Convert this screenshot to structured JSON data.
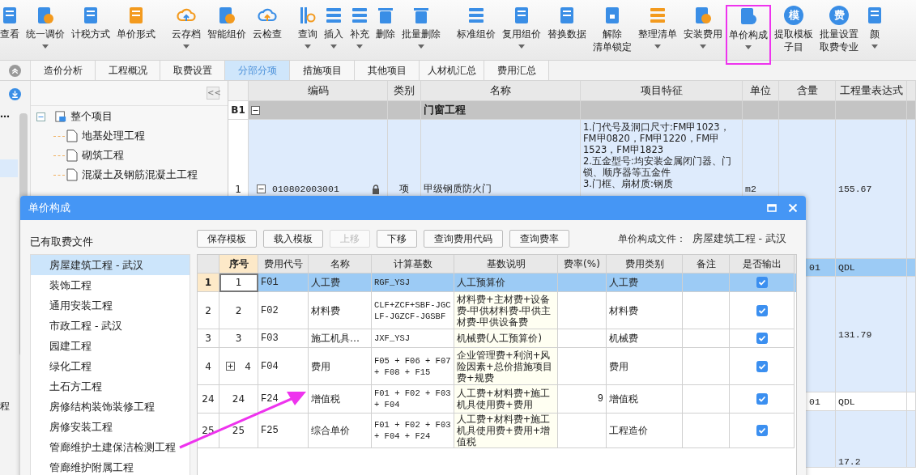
{
  "toolbar": {
    "groups": [
      [
        {
          "lines": [
            "查看"
          ],
          "dropdown": false,
          "highlighted": false
        },
        {
          "lines": [
            "统一调价"
          ],
          "dropdown": true,
          "highlighted": false
        },
        {
          "lines": [
            "计税方式"
          ],
          "dropdown": false,
          "highlighted": false
        },
        {
          "lines": [
            "单价形式"
          ],
          "dropdown": false,
          "highlighted": false
        }
      ],
      [
        {
          "lines": [
            "云存档"
          ],
          "dropdown": true,
          "highlighted": false
        },
        {
          "lines": [
            "智能组价"
          ],
          "dropdown": false,
          "highlighted": false
        },
        {
          "lines": [
            "云检查"
          ],
          "dropdown": false,
          "highlighted": false
        }
      ],
      [
        {
          "lines": [
            "查询"
          ],
          "dropdown": true,
          "highlighted": false
        },
        {
          "lines": [
            "插入"
          ],
          "dropdown": true,
          "highlighted": false
        },
        {
          "lines": [
            "补充"
          ],
          "dropdown": true,
          "highlighted": false
        },
        {
          "lines": [
            "删除"
          ],
          "dropdown": false,
          "highlighted": false
        },
        {
          "lines": [
            "批量删除"
          ],
          "dropdown": true,
          "highlighted": false
        }
      ],
      [
        {
          "lines": [
            "标准组价"
          ],
          "dropdown": false,
          "highlighted": false
        },
        {
          "lines": [
            "复用组价"
          ],
          "dropdown": true,
          "highlighted": false
        },
        {
          "lines": [
            "替换数据"
          ],
          "dropdown": false,
          "highlighted": false
        },
        {
          "lines": [
            "解除",
            "清单锁定"
          ],
          "dropdown": false,
          "highlighted": false
        },
        {
          "lines": [
            "整理清单"
          ],
          "dropdown": true,
          "highlighted": false
        },
        {
          "lines": [
            "安装费用"
          ],
          "dropdown": true,
          "highlighted": false
        },
        {
          "lines": [
            "单价构成"
          ],
          "dropdown": true,
          "highlighted": true
        },
        {
          "lines": [
            "提取模板",
            "子目"
          ],
          "dropdown": false,
          "highlighted": false,
          "icon_text": "模"
        },
        {
          "lines": [
            "批量设置",
            "取费专业"
          ],
          "dropdown": false,
          "highlighted": false,
          "icon_text": "费"
        },
        {
          "lines": [
            "颜"
          ],
          "dropdown": true,
          "highlighted": false
        }
      ]
    ]
  },
  "tabs": [
    {
      "label": "造价分析",
      "selected": false
    },
    {
      "label": "工程概况",
      "selected": false
    },
    {
      "label": "取费设置",
      "selected": false
    },
    {
      "label": "分部分项",
      "selected": true
    },
    {
      "label": "措施项目",
      "selected": false
    },
    {
      "label": "其他项目",
      "selected": false
    },
    {
      "label": "人材机汇总",
      "selected": false
    },
    {
      "label": "费用汇总",
      "selected": false
    }
  ],
  "left_strip": {
    "cut_item": "…",
    "cut_text": "程"
  },
  "tree": {
    "collapse_button": "<<",
    "root": {
      "label": "整个项目",
      "expanded": true,
      "children": [
        {
          "label": "地基处理工程"
        },
        {
          "label": "砌筑工程"
        },
        {
          "label": "混凝土及钢筋混凝土工程"
        }
      ]
    }
  },
  "grid": {
    "columns": [
      "编码",
      "类别",
      "名称",
      "项目特征",
      "单位",
      "含量",
      "工程量表达式"
    ],
    "rows": [
      {
        "kind": "group",
        "row_no": "B1",
        "expanded": true,
        "name": "门窗工程",
        "selected": false
      },
      {
        "kind": "item",
        "row_no": "1",
        "code": "010802003001",
        "expanded": true,
        "locked": true,
        "type": "项",
        "name": "甲级钢质防火门",
        "features": [
          "1.门代号及洞口尺寸:FM甲1023，FM甲0820，FM甲1220，FM甲1523，FM甲1823",
          "2.五金型号:均安装金属闭门器、门锁、顺序器等五金件",
          "3.门框、扇材质:钢质"
        ],
        "unit": "m2",
        "expression": "155.67",
        "selected": false
      },
      {
        "kind": "other",
        "content": "01",
        "expression": "QDL",
        "selected": true
      },
      {
        "kind": "other",
        "expression": "131.79",
        "selected": false
      },
      {
        "kind": "other",
        "content": "01",
        "expression": "QDL",
        "selected": false
      },
      {
        "kind": "other",
        "expression": "17.2",
        "selected": false
      }
    ]
  },
  "dialog": {
    "title": "单价构成",
    "fee_files_label": "已有取费文件",
    "fee_files": [
      {
        "label": "房屋建筑工程 - 武汉",
        "selected": true
      },
      {
        "label": "装饰工程",
        "selected": false
      },
      {
        "label": "通用安装工程",
        "selected": false
      },
      {
        "label": "市政工程 - 武汉",
        "selected": false
      },
      {
        "label": "园建工程",
        "selected": false
      },
      {
        "label": "绿化工程",
        "selected": false
      },
      {
        "label": "土石方工程",
        "selected": false
      },
      {
        "label": "房修结构装饰装修工程",
        "selected": false
      },
      {
        "label": "房修安装工程",
        "selected": false
      },
      {
        "label": "管廊维护土建保洁检测工程",
        "selected": false
      },
      {
        "label": "管廊维护附属工程",
        "selected": false
      }
    ],
    "buttons": [
      {
        "label": "保存模板",
        "disabled": false
      },
      {
        "label": "载入模板",
        "disabled": false
      },
      {
        "label": "上移",
        "disabled": true
      },
      {
        "label": "下移",
        "disabled": false
      },
      {
        "label": "查询费用代码",
        "disabled": false
      },
      {
        "label": "查询费率",
        "disabled": false
      }
    ],
    "file_label": "单价构成文件：",
    "file_value": "房屋建筑工程 - 武汉",
    "table": {
      "columns": [
        "序号",
        "费用代号",
        "名称",
        "计算基数",
        "基数说明",
        "费率(%)",
        "费用类别",
        "备注",
        "是否输出"
      ],
      "rows": [
        {
          "row_no": "1",
          "seq": "1",
          "code": "F01",
          "name": "人工费",
          "base": "RGF_YSJ",
          "base_desc": "人工预算价",
          "category": "人工费",
          "output": true,
          "selected": true,
          "expandable": false
        },
        {
          "row_no": "2",
          "seq": "2",
          "code": "F02",
          "name": "材料费",
          "base": "CLF+ZCF+SBF-JGCLF-JGZCF-JGSBF",
          "base_desc": "材料费+主材费+设备费-甲供材料费-甲供主材费-甲供设备费",
          "category": "材料费",
          "output": true,
          "selected": false,
          "expandable": false
        },
        {
          "row_no": "3",
          "seq": "3",
          "code": "F03",
          "name": "施工机具…",
          "base": "JXF_YSJ",
          "base_desc": "机械费(人工预算价)",
          "category": "机械费",
          "output": true,
          "selected": false,
          "expandable": false
        },
        {
          "row_no": "4",
          "seq": "4",
          "code": "F04",
          "name": "费用",
          "base": "F05 + F06 + F07 + F08 + F15",
          "base_desc": "企业管理费+利润+风险因素+总价措施项目费+规费",
          "category": "费用",
          "output": true,
          "selected": false,
          "expandable": true
        },
        {
          "row_no": "24",
          "seq": "24",
          "code": "F24",
          "name": "增值税",
          "base": "F01 + F02 + F03 + F04",
          "base_desc": "人工费+材料费+施工机具使用费+费用",
          "rate": "9",
          "category": "增值税",
          "output": true,
          "selected": false,
          "expandable": false
        },
        {
          "row_no": "25",
          "seq": "25",
          "code": "F25",
          "name": "综合单价",
          "base": "F01 + F02 + F03 + F04 + F24",
          "base_desc": "人工费+材料费+施工机具使用费+费用+增值税",
          "category": "工程造价",
          "output": true,
          "selected": false,
          "expandable": false
        }
      ]
    }
  }
}
